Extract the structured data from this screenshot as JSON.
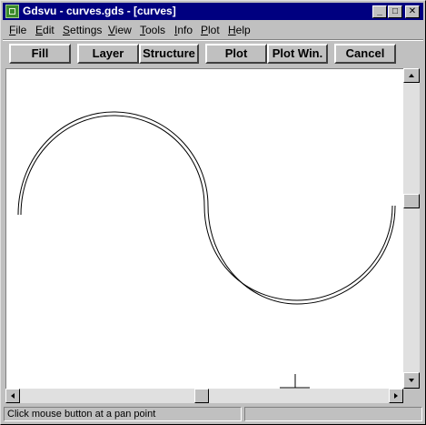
{
  "window": {
    "title": "Gdsvu - curves.gds - [curves]",
    "minimize_glyph": "_",
    "maximize_glyph": "□",
    "close_glyph": "✕"
  },
  "menu": [
    {
      "mnemonic": "F",
      "rest": "ile"
    },
    {
      "mnemonic": "E",
      "rest": "dit"
    },
    {
      "mnemonic": "S",
      "rest": "ettings"
    },
    {
      "mnemonic": "V",
      "rest": "iew"
    },
    {
      "mnemonic": "T",
      "rest": "ools"
    },
    {
      "mnemonic": "I",
      "rest": "nfo"
    },
    {
      "mnemonic": "P",
      "rest": "lot"
    },
    {
      "mnemonic": "H",
      "rest": "elp"
    }
  ],
  "toolbar": {
    "fill": "Fill",
    "layer": "Layer",
    "structure": "Structure",
    "plot": "Plot",
    "plot_win": "Plot Win.",
    "cancel": "Cancel"
  },
  "status": {
    "message": "Click mouse button at a pan point",
    "right_pane": ""
  },
  "drawing": {
    "shape": "s-curve",
    "color": "#000000"
  },
  "colors": {
    "titlebar": "#000080",
    "face": "#c0c0c0",
    "canvas": "#ffffff"
  }
}
